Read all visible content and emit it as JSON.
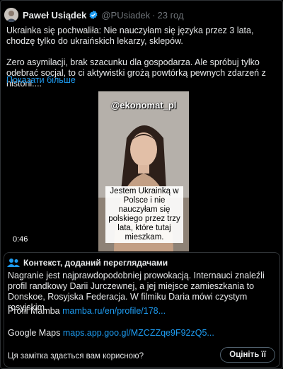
{
  "tweet": {
    "author_name": "Paweł Usiądek",
    "handle": "@PUsiadek",
    "separator": "·",
    "time": "23 год",
    "text": "Ukrainka się pochwaliła: Nie nauczyłam się języka przez 3 lata, chodzę tylko do ukraińskich lekarzy, sklepów.\n\nZero asymilacji, brak szacunku dla gospodarza. Ale spróbuj tylko odebrać socjal, to ci aktywistki grożą powtórką pewnych zdarzeń z historii....",
    "show_more": "Показати більше",
    "verified_color": "#1d9bf0"
  },
  "video": {
    "watermark": "@ekonomat_pl",
    "caption": "Jestem Ukrainką w Polsce i nie nauczyłam się polskiego przez trzy lata, które tutaj mieszkam.",
    "duration": "0:46"
  },
  "note": {
    "title": "Контекст, доданий переглядачами",
    "body": "Nagranie jest najprawdopodobniej prowokacją. Internauci znaleźli profil randkowy Darii Jurczewnej, a jej miejsce zamieszkania to Donskoe, Rosyjska Federacja. W filmiku Daria mówi czystym rosyjskim.",
    "link1_label": "Profil Mamba",
    "link1_url": "mamba.ru/en/profile/178...",
    "link2_label": "Google Maps",
    "link2_url": "maps.app.goo.gl/MZCZZqe9F92zQ5...",
    "feedback_question": "Ця замітка здається вам корисною?",
    "rate_button": "Оцініть її",
    "icon": "users-icon",
    "accent": "#1d9bf0"
  }
}
